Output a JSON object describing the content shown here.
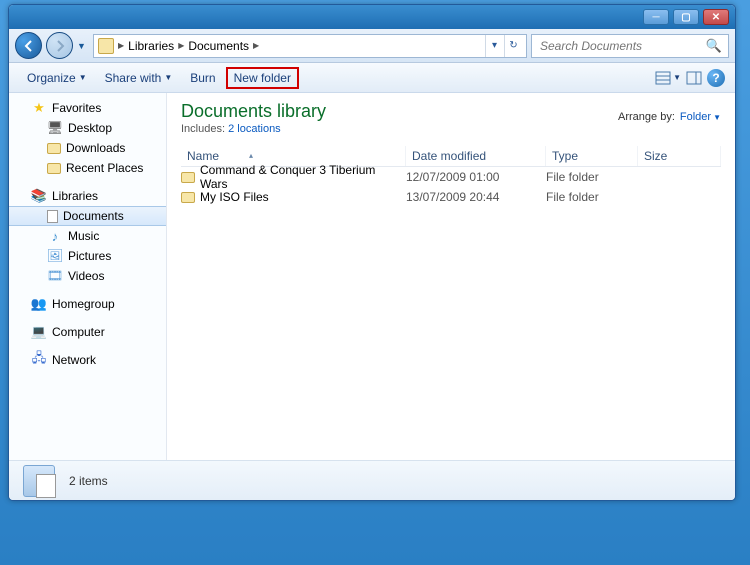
{
  "breadcrumbs": [
    "Libraries",
    "Documents"
  ],
  "search": {
    "placeholder": "Search Documents"
  },
  "toolbar": {
    "organize": "Organize",
    "share": "Share with",
    "burn": "Burn",
    "newfolder": "New folder"
  },
  "nav": {
    "favorites": "Favorites",
    "fav_items": [
      "Desktop",
      "Downloads",
      "Recent Places"
    ],
    "libraries": "Libraries",
    "lib_items": [
      "Documents",
      "Music",
      "Pictures",
      "Videos"
    ],
    "homegroup": "Homegroup",
    "computer": "Computer",
    "network": "Network"
  },
  "library": {
    "title": "Documents library",
    "includes_label": "Includes:",
    "locations": "2 locations",
    "arrange_label": "Arrange by:",
    "arrange_value": "Folder"
  },
  "columns": {
    "name": "Name",
    "date": "Date modified",
    "type": "Type",
    "size": "Size"
  },
  "rows": [
    {
      "name": "Command & Conquer 3 Tiberium Wars",
      "date": "12/07/2009 01:00",
      "type": "File folder"
    },
    {
      "name": "My ISO Files",
      "date": "13/07/2009 20:44",
      "type": "File folder"
    }
  ],
  "status": {
    "count": "2 items"
  }
}
